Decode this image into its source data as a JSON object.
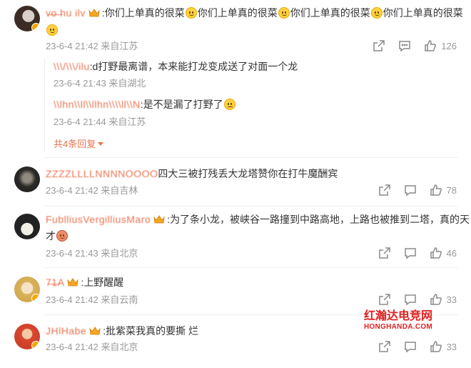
{
  "comments": [
    {
      "username": "v̶o̶ ̶hu ilv",
      "text_main": "你们上单真的很菜",
      "text_1": "你们上单真的很菜",
      "text_2": "你们上单真的很菜",
      "text_3": "你们上单真的很菜",
      "time": "23-6-4 21:42",
      "location": "来自江苏",
      "likes": "126",
      "replies": [
        {
          "username": "\\\\\\/\\\\\\/ilu",
          "text": "d打野最离谱，本来能打龙变成送了对面一个龙",
          "time": "23-6-4 21:43",
          "location": "来自湖北"
        },
        {
          "username": "\\\\lhn\\\\ll\\\\llhn\\\\\\\\ll\\\\N",
          "text": "是不是漏了打野了",
          "time": "23-6-4 21:44",
          "location": "来自江苏"
        }
      ],
      "more_label": "共4条回复"
    },
    {
      "username": "ZZZZLLLLNNNNOOOO",
      "text": "四大三被打残丢大龙塔赞你在打牛魔酬宾",
      "time": "23-6-4 21:42",
      "location": "来自吉林",
      "likes": "78"
    },
    {
      "username": "FublliusVergilliusMaro",
      "text_line1": "为了条小龙，被峡谷一路撞到中路高地，上路也被推到二塔，真的天",
      "text_line2": "才",
      "time": "23-6-4 21:43",
      "location": "来自北京",
      "likes": "46"
    },
    {
      "username": "7̶1̶A",
      "text": "上野醒醒",
      "time": "23-6-4 21:42",
      "location": "来自云南",
      "likes": "33"
    },
    {
      "username": "JHlHabe",
      "text": "批紫菜我真的要撕 烂",
      "time": "23-6-4 21:42",
      "location": "来自北京",
      "likes": "33"
    }
  ],
  "watermark": {
    "top": "红瀚达电竞网",
    "bottom": "HONGHANDA.COM"
  },
  "colors": {
    "username": "#eb7350",
    "meta": "#999999",
    "watermark": "#e02020"
  },
  "icons": {
    "share": "share-icon",
    "comment": "comment-icon",
    "like": "like-icon"
  }
}
